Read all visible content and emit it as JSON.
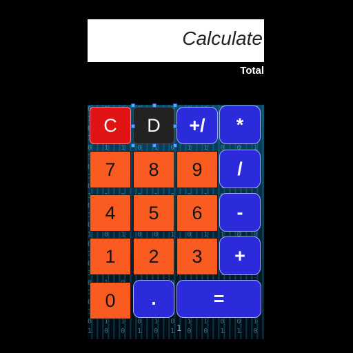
{
  "display": {
    "text": "Calculate"
  },
  "total_label": "Total",
  "buttons": {
    "clear": "C",
    "delete": "D",
    "sign": "+/",
    "multiply": "*",
    "divide": "/",
    "subtract": "-",
    "add": "+",
    "decimal": ".",
    "equals": "=",
    "digit_0": "0",
    "digit_1": "1",
    "digit_2": "2",
    "digit_3": "3",
    "digit_4": "4",
    "digit_5": "5",
    "digit_6": "6",
    "digit_7": "7",
    "digit_8": "8",
    "digit_9": "9"
  },
  "background_digit": "1",
  "colors": {
    "clear": "#e01414",
    "delete": "#222222",
    "operator": "#2b2bdc",
    "digit": "#fa5b20",
    "display": "#ffffff"
  }
}
